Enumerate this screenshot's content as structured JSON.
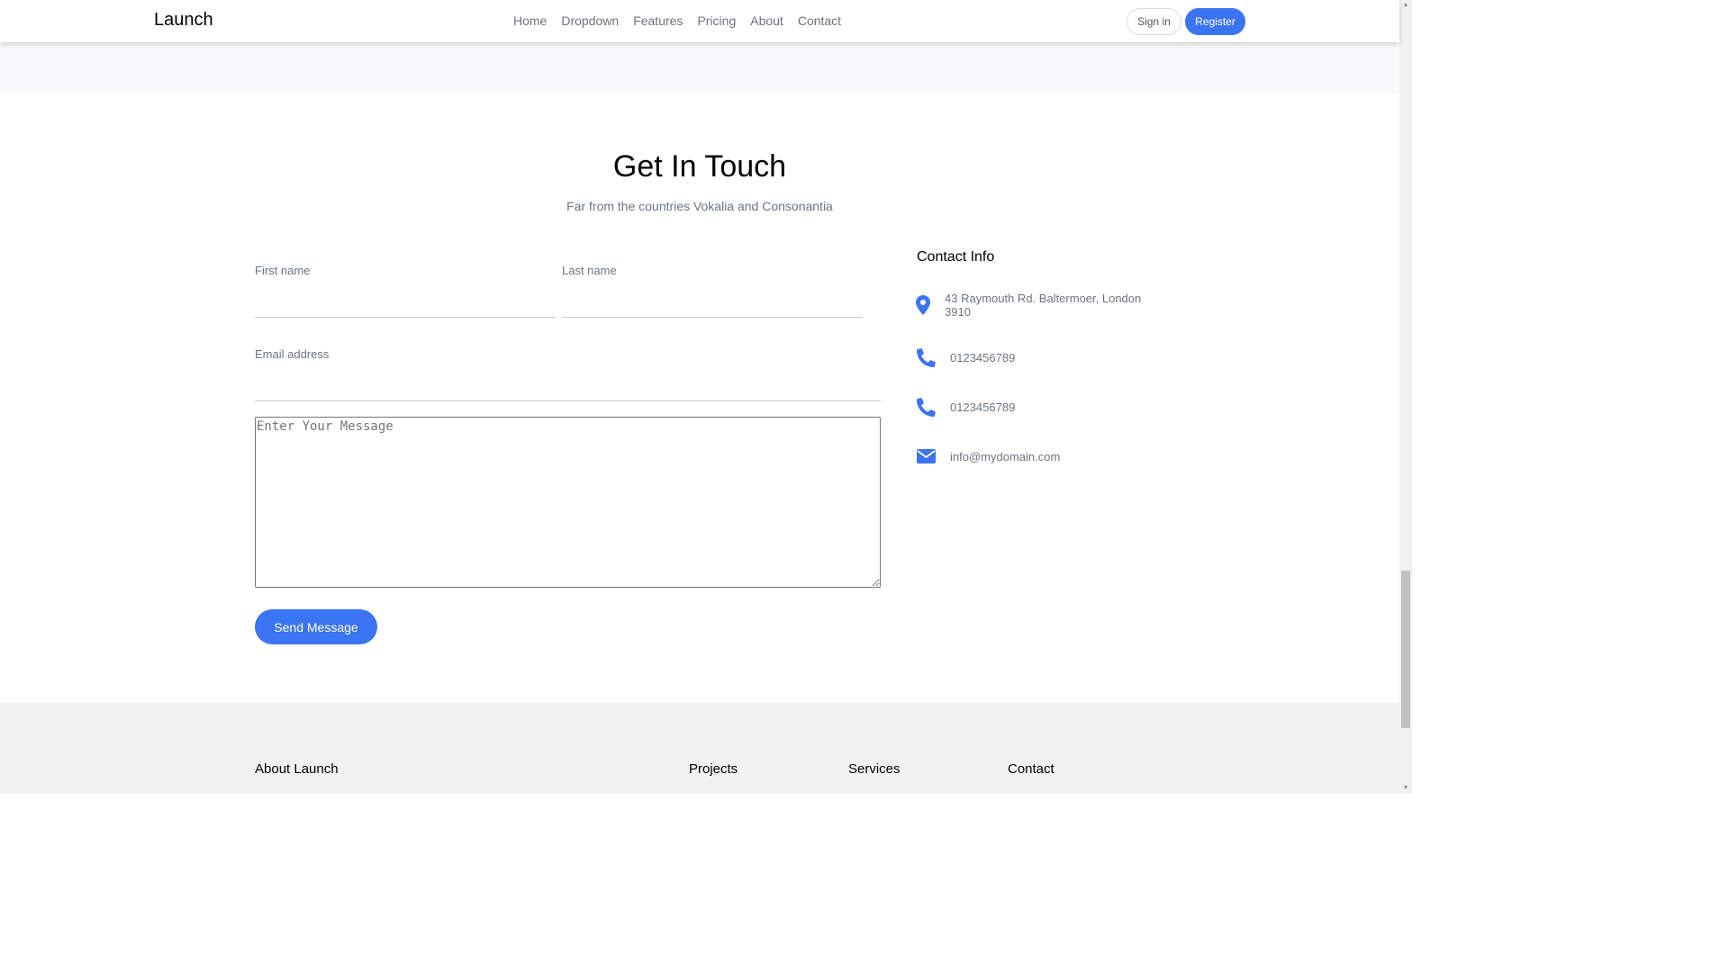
{
  "nav": {
    "brand": "Launch",
    "links": [
      "Home",
      "Dropdown",
      "Features",
      "Pricing",
      "About",
      "Contact"
    ],
    "signin_label": "Sign in",
    "register_label": "Register"
  },
  "contact": {
    "title": "Get In Touch",
    "subtitle": "Far from the countries Vokalia and Consonantia",
    "first_name_label": "First name",
    "last_name_label": "Last name",
    "email_label": "Email address",
    "message_placeholder": "Enter Your Message",
    "send_label": "Send Message"
  },
  "contact_info": {
    "title": "Contact Info",
    "address": "43 Raymouth Rd. Baltermoer, London 3910",
    "phone1": "0123456789",
    "phone2": "0123456789",
    "email": "info@mydomain.com"
  },
  "footer": {
    "about": "About Launch",
    "projects": "Projects",
    "services": "Services",
    "contact": "Contact"
  },
  "colors": {
    "accent": "#3b74f0",
    "muted_text": "#6c757d"
  }
}
